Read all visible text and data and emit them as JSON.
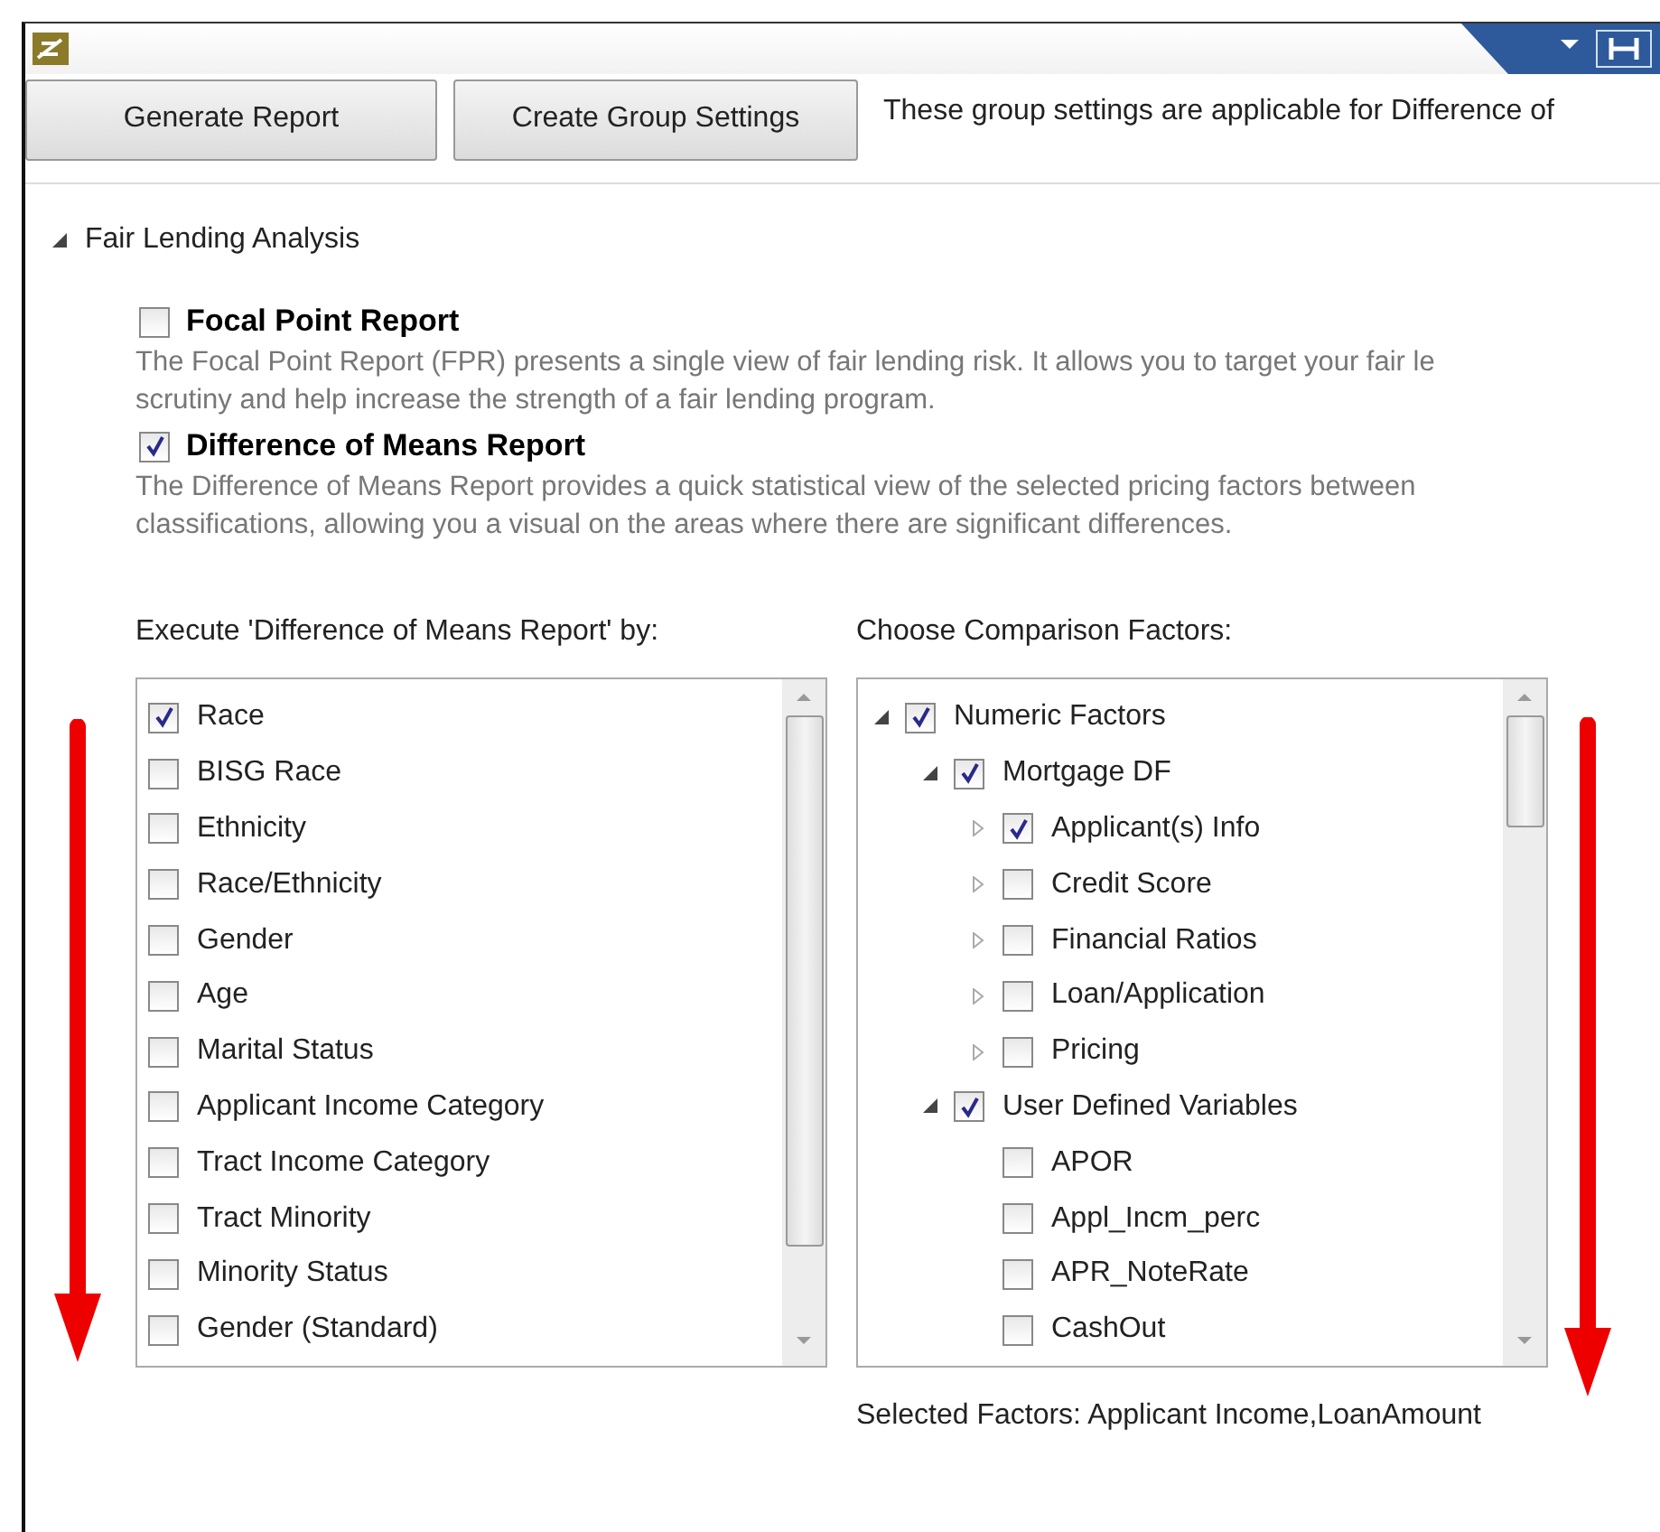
{
  "toolbar": {
    "buttons": [
      "Generate Report",
      "Create Group Settings"
    ],
    "note": "These group settings are applicable for Difference of"
  },
  "section": {
    "title": "Fair Lending Analysis",
    "expanded": true
  },
  "reports": [
    {
      "label": "Focal Point Report",
      "checked": false,
      "description": [
        "The Focal Point Report (FPR) presents a single view of fair lending risk.  It allows you to target your fair le",
        "scrutiny and help increase the strength of a fair lending program."
      ]
    },
    {
      "label": "Difference of Means Report",
      "checked": true,
      "description": [
        "The Difference of Means Report provides a quick statistical view of the selected pricing factors between",
        "classifications, allowing you a visual on the areas where there are significant differences."
      ]
    }
  ],
  "execute_by": {
    "label": "Execute 'Difference of Means Report' by:",
    "items": [
      {
        "label": "Race",
        "checked": true
      },
      {
        "label": "BISG Race",
        "checked": false
      },
      {
        "label": "Ethnicity",
        "checked": false
      },
      {
        "label": "Race/Ethnicity",
        "checked": false
      },
      {
        "label": "Gender",
        "checked": false
      },
      {
        "label": "Age",
        "checked": false
      },
      {
        "label": "Marital Status",
        "checked": false
      },
      {
        "label": "Applicant Income Category",
        "checked": false
      },
      {
        "label": "Tract Income Category",
        "checked": false
      },
      {
        "label": "Tract Minority",
        "checked": false
      },
      {
        "label": "Minority Status",
        "checked": false
      },
      {
        "label": "Gender (Standard)",
        "checked": false
      }
    ]
  },
  "comparison": {
    "label": "Choose Comparison Factors:",
    "tree": [
      {
        "label": "Numeric Factors",
        "checked": true,
        "expanded": true,
        "children": [
          {
            "label": "Mortgage DF",
            "checked": true,
            "expanded": true,
            "children": [
              {
                "label": "Applicant(s) Info",
                "checked": true,
                "expanded": false
              },
              {
                "label": "Credit Score",
                "checked": false,
                "expanded": false
              },
              {
                "label": "Financial Ratios",
                "checked": false,
                "expanded": false
              },
              {
                "label": "Loan/Application",
                "checked": false,
                "expanded": false
              },
              {
                "label": "Pricing",
                "checked": false,
                "expanded": false
              }
            ]
          },
          {
            "label": "User Defined Variables",
            "checked": true,
            "expanded": true,
            "children": [
              {
                "label": "APOR",
                "checked": false
              },
              {
                "label": "Appl_Incm_perc",
                "checked": false
              },
              {
                "label": "APR_NoteRate",
                "checked": false
              },
              {
                "label": "CashOut",
                "checked": false
              }
            ]
          }
        ]
      }
    ],
    "selected_factors": "Selected Factors: Applicant Income,LoanAmount"
  }
}
